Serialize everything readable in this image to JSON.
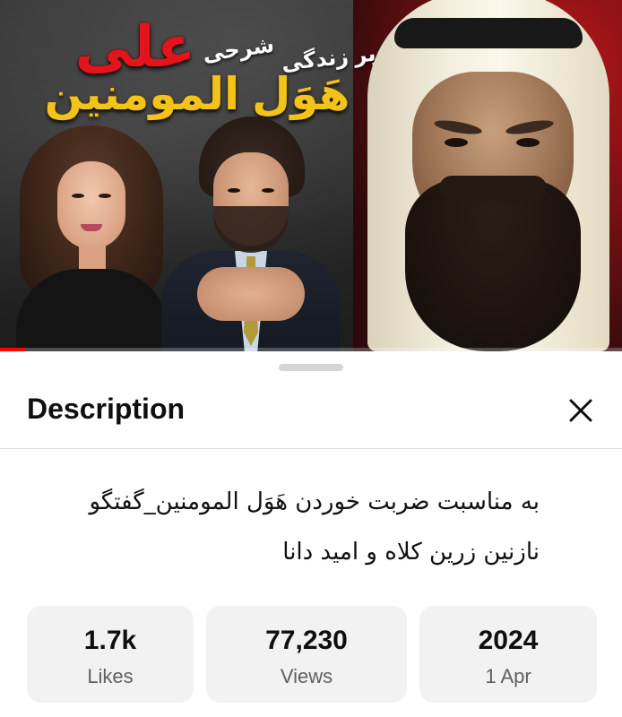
{
  "video": {
    "thumbnail": {
      "title_small_1": "شرحی",
      "title_small_2": "بر زندگی",
      "title_red": "علی",
      "title_yellow": "هَوَل المومنین"
    },
    "progress_fraction": 0.04,
    "colors": {
      "progress": "#ff0000",
      "title_red": "#e3141b",
      "title_yellow": "#f2c318"
    }
  },
  "sheet": {
    "title": "Description",
    "close_icon": "close-icon",
    "description_lines": [
      "به مناسبت ضربت خوردن هَوَل المومنین_گفتگو",
      "نازنین زرین کلاه و امید دانا"
    ],
    "stats": {
      "likes": {
        "value": "1.7k",
        "label": "Likes"
      },
      "views": {
        "value": "77,230",
        "label": "Views"
      },
      "date": {
        "value": "2024",
        "label": "1 Apr"
      }
    }
  }
}
